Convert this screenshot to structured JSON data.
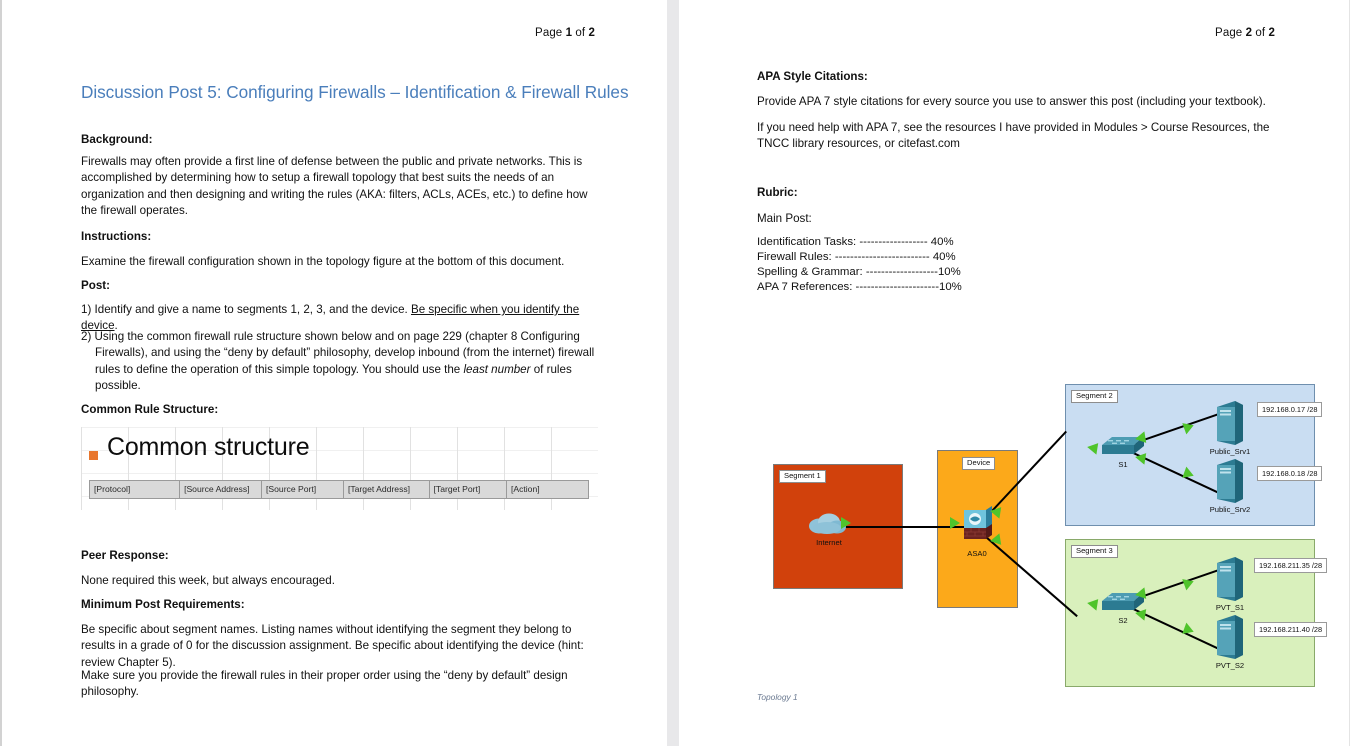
{
  "document": {
    "title": "Discussion Post 5: Configuring Firewalls – Identification & Firewall Rules",
    "title_color": "#4a7ebb"
  },
  "page1": {
    "page_label_prefix": "Page ",
    "page_label_current": "1",
    "page_label_mid": " of ",
    "page_label_total": "2",
    "background_heading": "Background:",
    "background_text": "Firewalls may often provide a first line of defense between the public and private networks. This is accomplished by determining how to setup a firewall topology that best suits the needs of an organization and then designing and writing the rules (AKA: filters, ACLs, ACEs, etc.) to define how the firewall operates.",
    "instructions_heading": "Instructions:",
    "instructions_text": "Examine the firewall configuration shown in the topology figure at the bottom of this document.",
    "post_heading": "Post:",
    "post_item1_a": "1) Identify and give a name to segments 1, 2, 3, and the device. ",
    "post_item1_underlined": "Be specific when you identify the device",
    "post_item1_b": ".",
    "post_item2_a": "2) Using the common firewall rule structure shown below and on page 229 (chapter 8 Configuring Firewalls), and using the “deny by default” philosophy, develop inbound (from the internet) firewall rules to define the operation of this simple topology. You should use the ",
    "post_item2_italic": "least number",
    "post_item2_b": " of rules possible.",
    "common_rule_heading": "Common Rule Structure:",
    "slide": {
      "bullet_color": "#e8762d",
      "title": "Common structure",
      "table_headers": [
        "[Protocol]",
        "[Source Address]",
        "[Source Port]",
        "[Target Address]",
        "[Target Port]",
        "[Action]"
      ]
    },
    "peer_response_heading": "Peer Response:",
    "peer_response_text": "None required this week, but always encouraged.",
    "minimum_heading": "Minimum Post Requirements:",
    "minimum_text_1": "Be specific about segment names. Listing names without identifying the segment they belong to results in a grade of 0 for the discussion assignment. Be specific about identifying the device (hint: review Chapter 5).",
    "minimum_text_2": "Make sure you provide the firewall rules in their proper order using the “deny by default” design philosophy."
  },
  "page2": {
    "page_label_prefix": "Page ",
    "page_label_current": "2",
    "page_label_mid": " of ",
    "page_label_total": "2",
    "apa_heading": "APA Style Citations:",
    "apa_text_1": "Provide APA 7 style citations for every source you use to answer this post (including your textbook).",
    "apa_text_2": "If you need help with APA 7, see the resources I have provided in Modules > Course Resources, the TNCC library resources, or citefast.com",
    "rubric_heading": "Rubric:",
    "main_post_label": "Main Post:",
    "rubric_lines": [
      "Identification Tasks: ------------------ 40%",
      "Firewall Rules: ------------------------- 40%",
      "Spelling & Grammar: -------------------10%",
      "APA 7 References: ----------------------10%"
    ],
    "figure_caption": "Topology 1"
  },
  "topology": {
    "segments": [
      {
        "id": "segment-1",
        "label": "Segment 1",
        "color": "#d1410c"
      },
      {
        "id": "device",
        "label": "Device",
        "color": "#fca91a"
      },
      {
        "id": "segment-2",
        "label": "Segment 2",
        "color": "#c9ddf2"
      },
      {
        "id": "segment-3",
        "label": "Segment 3",
        "color": "#d9f0bc"
      }
    ],
    "nodes": [
      {
        "id": "internet",
        "label": "Internet",
        "type": "cloud"
      },
      {
        "id": "asa0",
        "label": "ASA0",
        "type": "firewall"
      },
      {
        "id": "s1",
        "label": "S1",
        "type": "switch"
      },
      {
        "id": "s2",
        "label": "S2",
        "type": "switch"
      },
      {
        "id": "public-srv1",
        "label": "Public_Srv1",
        "type": "server",
        "ip": "192.168.0.17 /28"
      },
      {
        "id": "public-srv2",
        "label": "Public_Srv2",
        "type": "server",
        "ip": "192.168.0.18 /28"
      },
      {
        "id": "pvt-s1",
        "label": "PVT_S1",
        "type": "server",
        "ip": "192.168.211.35 /28"
      },
      {
        "id": "pvt-s2",
        "label": "PVT_S2",
        "type": "server",
        "ip": "192.168.211.40 /28"
      }
    ],
    "links": [
      {
        "from": "internet",
        "to": "asa0"
      },
      {
        "from": "asa0",
        "to": "s1"
      },
      {
        "from": "asa0",
        "to": "s2"
      },
      {
        "from": "s1",
        "to": "public-srv1"
      },
      {
        "from": "s1",
        "to": "public-srv2"
      },
      {
        "from": "s2",
        "to": "pvt-s1"
      },
      {
        "from": "s2",
        "to": "pvt-s2"
      }
    ],
    "link_status_color": "#4fc42b"
  }
}
